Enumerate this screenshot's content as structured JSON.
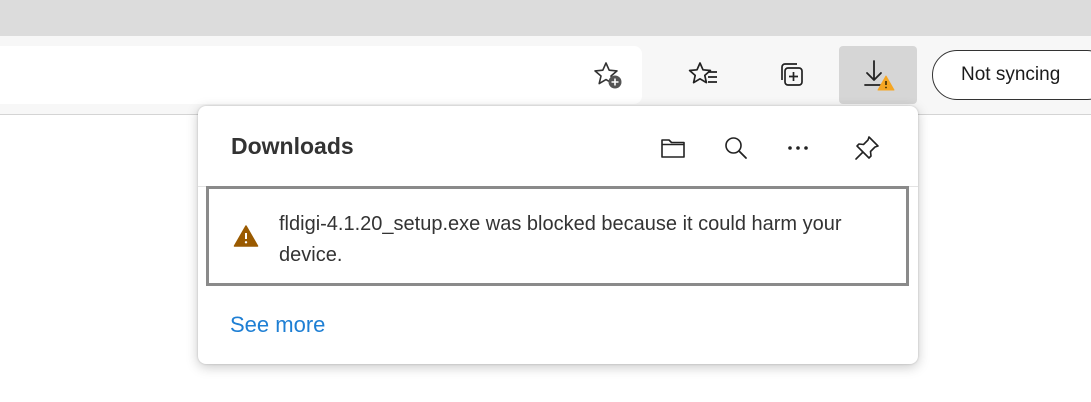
{
  "toolbar": {
    "sync_label": "Not syncing"
  },
  "icons": {
    "add_favorite": "star-plus-icon",
    "favorites": "favorites-list-icon",
    "collections": "collections-icon",
    "downloads": "download-arrow-icon",
    "download_warning": "warning-triangle-icon",
    "open_folder": "folder-icon",
    "search": "search-icon",
    "more": "more-options-icon",
    "pin": "pin-icon"
  },
  "downloads_panel": {
    "title": "Downloads",
    "items": [
      {
        "message": "fldigi-4.1.20_setup.exe was blocked because it could harm your device.",
        "status_icon": "warning-triangle-icon"
      }
    ],
    "see_more_label": "See more"
  },
  "colors": {
    "warning": "#f5a623",
    "warning_dark": "#9a5a00",
    "link": "#1e7fd4",
    "active_button_bg": "#d6d6d6"
  }
}
